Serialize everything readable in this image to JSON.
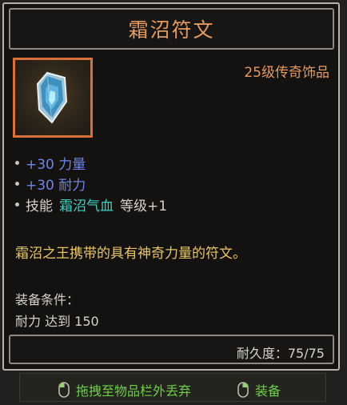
{
  "item": {
    "name": "霜沼符文",
    "rarity": "25级传奇饰品",
    "icon": "rune-crystal-icon",
    "stats": [
      {
        "text": "+30 力量",
        "color": "#6f86e6"
      },
      {
        "text": "+30 耐力",
        "color": "#6f86e6"
      }
    ],
    "skill": {
      "prefix": "技能",
      "name": "霜沼气血",
      "suffix": "等级+1"
    },
    "description": "霜沼之王携带的具有神奇力量的符文。",
    "requirement_label": "装备条件：",
    "requirement_value": "耐力 达到 150",
    "durability": "耐久度：75/75"
  },
  "hints": {
    "drop_label": "拖拽至物品栏外丢弃",
    "equip_label": "装备"
  },
  "colors": {
    "title": "#e39a62",
    "legendary_border": "#d9703a",
    "stat_blue": "#6f86e6",
    "skill_cyan": "#3fd0c2",
    "description_gold": "#e8c56a",
    "hint_green": "#6fcf4a"
  }
}
